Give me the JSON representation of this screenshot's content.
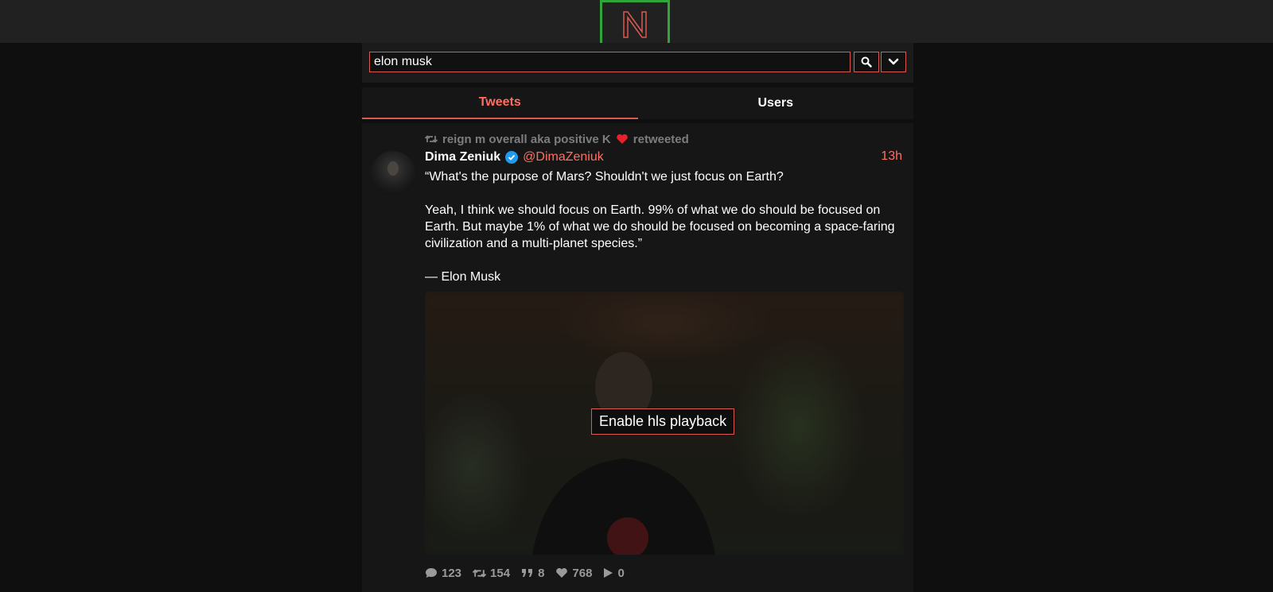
{
  "logo": {
    "letter": "N",
    "color": "#d95a50",
    "border_color": "#2fa53a"
  },
  "search": {
    "value": "elon musk",
    "placeholder": ""
  },
  "tabs": [
    {
      "label": "Tweets",
      "active": true
    },
    {
      "label": "Users",
      "active": false
    }
  ],
  "tweet": {
    "retweet_line": {
      "user": "reign m overall aka positive K",
      "emoji": "heart-icon",
      "suffix": "retweeted"
    },
    "author_name": "Dima Zeniuk",
    "author_handle": "@DimaZeniuk",
    "verified": true,
    "time": "13h",
    "body": {
      "p1": "“What's the purpose of Mars? Shouldn't we just focus on Earth?",
      "p2": "Yeah, I think we should focus on Earth. 99% of what we do should be focused on Earth. But maybe 1% of what we do should be focused on becoming a space-faring civilization and a multi-planet species.”",
      "p3": "— Elon Musk"
    },
    "media": {
      "button_label": "Enable hls playback"
    },
    "stats": {
      "replies": "123",
      "retweets": "154",
      "quotes": "8",
      "likes": "768",
      "views": "0"
    }
  },
  "colors": {
    "accent": "#d95a50",
    "accent_text": "#ff6f61",
    "background": "#0f0f0f",
    "panel": "#161616",
    "verified": "#1d9bf0"
  }
}
